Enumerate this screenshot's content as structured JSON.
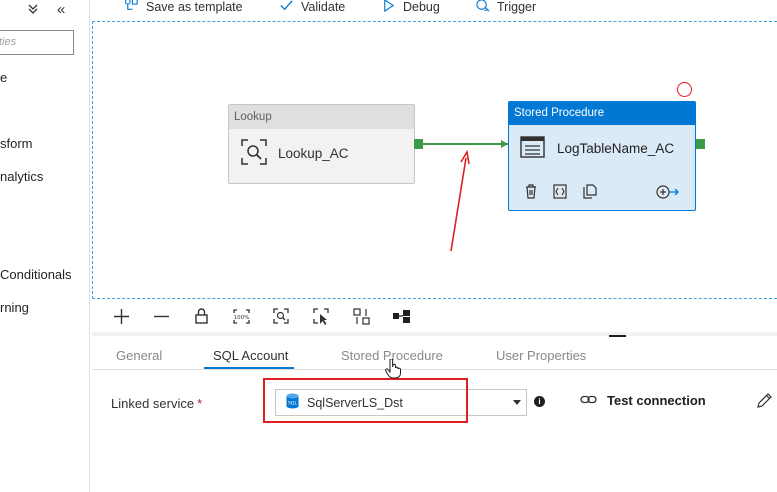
{
  "sidebar": {
    "collapse_label": "«",
    "expand_label": "»",
    "search_placeholder": "ties",
    "items": [
      {
        "label": "e"
      },
      {
        "label": "sform"
      },
      {
        "label": "nalytics"
      },
      {
        "label": "Conditionals"
      },
      {
        "label": "rning"
      }
    ]
  },
  "toolbar": {
    "save_template": "Save as template",
    "validate": "Validate",
    "debug": "Debug",
    "trigger": "Trigger"
  },
  "canvas": {
    "lookup": {
      "type_label": "Lookup",
      "name": "Lookup_AC"
    },
    "stored_procedure": {
      "type_label": "Stored Procedure",
      "name": "LogTableName_AC"
    }
  },
  "tabs": [
    {
      "label": "General"
    },
    {
      "label": "SQL Account"
    },
    {
      "label": "Stored Procedure"
    },
    {
      "label": "User Properties"
    }
  ],
  "active_tab": "SQL Account",
  "form": {
    "linked_service_label": "Linked service",
    "required_marker": "*",
    "linked_service_value": "SqlServerLS_Dst",
    "info_glyph": "i",
    "test_connection": "Test connection"
  },
  "colors": {
    "accent": "#0078d4",
    "success": "#3b9a47",
    "annotation": "#e02020"
  }
}
